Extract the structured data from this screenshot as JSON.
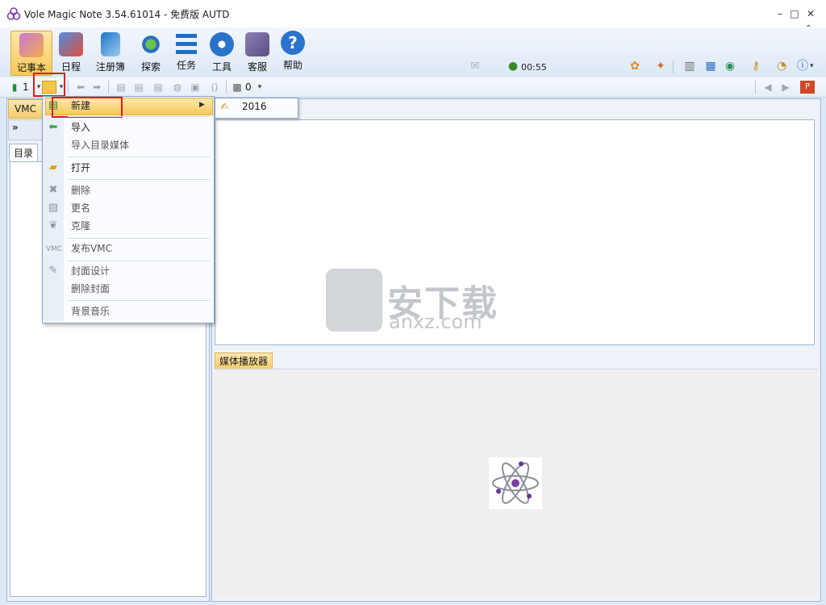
{
  "window": {
    "title": "Vole Magic Note  3.54.61014 - 免费版 AUTD",
    "minimize": "–",
    "maximize": "□",
    "close": "✕"
  },
  "ribbon": {
    "buttons": [
      {
        "label": "记事本",
        "icon": "notebook-icon"
      },
      {
        "label": "日程",
        "icon": "calendar-clock-icon"
      },
      {
        "label": "注册簿",
        "icon": "register-book-icon"
      },
      {
        "label": "探索",
        "icon": "explore-icon"
      },
      {
        "label": "任务",
        "icon": "task-list-icon"
      },
      {
        "label": "工具",
        "icon": "tools-icon"
      },
      {
        "label": "客服",
        "icon": "support-icon"
      },
      {
        "label": "帮助",
        "icon": "help-icon"
      }
    ],
    "clock": "00:55"
  },
  "toolbar": {
    "notebook_count": "1",
    "media_count": "0"
  },
  "leftpane": {
    "vmc_label": "VMC",
    "tab_catalog": "目录"
  },
  "menu": {
    "new": "新建",
    "import": "导入",
    "import_media": "导入目录媒体",
    "open": "打开",
    "delete": "删除",
    "rename": "更名",
    "clone": "克隆",
    "publish": "发布VMC",
    "cover_design": "封面设计",
    "delete_cover": "删除封面",
    "bg_music": "背景音乐"
  },
  "submenu": {
    "item_2016": "2016"
  },
  "media": {
    "tab_label": "媒体播放器"
  },
  "watermark": {
    "cn": "安下载",
    "en": "anxz.com"
  }
}
